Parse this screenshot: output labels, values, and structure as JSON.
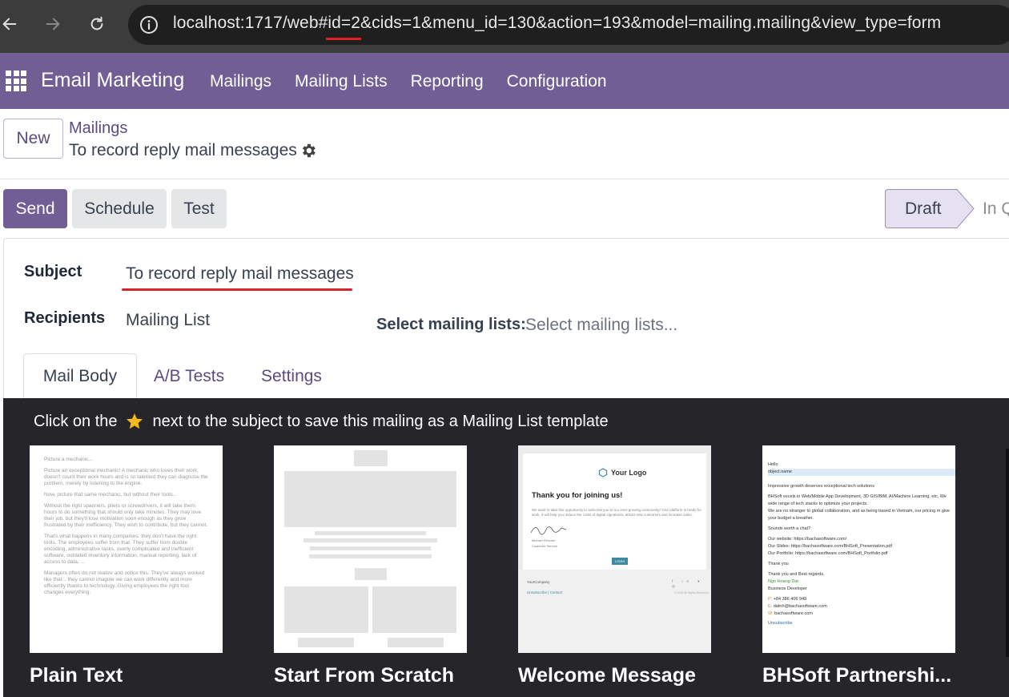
{
  "browser": {
    "url": "localhost:1717/web#id=2&cids=1&menu_id=130&action=193&model=mailing.mailing&view_type=form"
  },
  "app": {
    "brand": "Email Marketing",
    "menu": [
      "Mailings",
      "Mailing Lists",
      "Reporting",
      "Configuration"
    ]
  },
  "control": {
    "new_label": "New",
    "breadcrumb_parent": "Mailings",
    "breadcrumb_current": "To record reply mail messages"
  },
  "actions": {
    "send": "Send",
    "schedule": "Schedule",
    "test": "Test"
  },
  "status": {
    "current": "Draft",
    "next": "In Q"
  },
  "form": {
    "subject_label": "Subject",
    "subject_value": "To record reply mail messages",
    "recipients_label": "Recipients",
    "recipients_value": "Mailing List",
    "mailing_lists_label": "Select mailing lists:",
    "mailing_lists_placeholder": "Select mailing lists..."
  },
  "tabs": [
    "Mail Body",
    "A/B Tests",
    "Settings"
  ],
  "templates": {
    "hint_before": "Click on the",
    "hint_after": "next to the subject to save this mailing as a Mailing List template",
    "items": [
      {
        "name": "Plain Text"
      },
      {
        "name": "Start From Scratch"
      },
      {
        "name": "Welcome Message"
      },
      {
        "name": "BHSoft Partnershi..."
      }
    ],
    "plain_text_preview": [
      "Picture a mechanic...",
      "Picture an exceptional mechanic! A mechanic who loves their work, doesn't count their work hours and is so talented they can diagnose the problem, merely by listening to the engine.",
      "Now, picture that same mechanic, but without their tools...",
      "Without the right spanners, pliers or screwdrivers, it will take them hours to do something that should only take minutes. They may love their job, but they'll lose motivation soon enough as they grow frustrated by their inefficiency. They wish to contribute, but they cannot.",
      "That's what happens in many companies: they don't have the right tools. The employees suffer from that. They suffer from double encoding, administrative tasks, overly complicated and inefficient software, outdated inventory information, manual reporting, lack of access to data, ...",
      "Managers often do not realize and notice this. They've always worked like that... they cannot imagine we can work differently and more efficiently thanks to technology. Giving employees the right tool changes everything."
    ],
    "welcome_preview": {
      "logo": "Your Logo",
      "title": "Thank you for joining us!",
      "body": "We want to take this opportunity to welcome you to our ever-growing community! Your platform is ready for work, it will help you reduce the costs of digital signatures, attract new customers and increase sales.",
      "signer": "Michael Fletcher",
      "signer_role": "Customer Service",
      "login": "LOGIN",
      "company": "YourCompany",
      "links": "Unsubscribe | Contact",
      "social": "f in ▾ ◎",
      "rights": "© 2024 All Rights Reserved"
    },
    "bhsoft_preview": {
      "hello": "Hello",
      "object": "object.name",
      "headline": "Impressive growth deserves exceptional tech solutions",
      "p1": "BHSoft excels in Web/Mobile App Development, 3D GIS/BIM, AI/Machine Learning, etc. We wide range of tech stacks to optimize your projects.",
      "p2": "We are no stranger to global collaboration, and as being based in Vietnam, our pricing m give your budget a breather.",
      "chat": "Sounds worth a chat?",
      "web": "Our website: https://bachasoftware.com/",
      "slides": "Our Slides: https://bachasoftware.com/BHSoft_Presentation.pdf",
      "portfolio": "Our Portfolio: https://bachasoftware.com/BHSoft_Portfolio.pdf",
      "thanks": "Thank you",
      "regards": "Thank you and Best regards,",
      "name": "Ngo Hoang Dat",
      "role": "Business Developer",
      "phone_label": "P:",
      "phone": "+84 386 406 948",
      "email_label": "E:",
      "email": "datnh@bachasoftware.com",
      "web_label": "W:",
      "web2": "bachasoftware.com",
      "unsub": "Unsubscribe"
    }
  },
  "colors": {
    "brand_purple": "#715e95",
    "link_purple": "#5c4a80",
    "underline_red": "#d9242b",
    "template_bg": "#25252a"
  }
}
